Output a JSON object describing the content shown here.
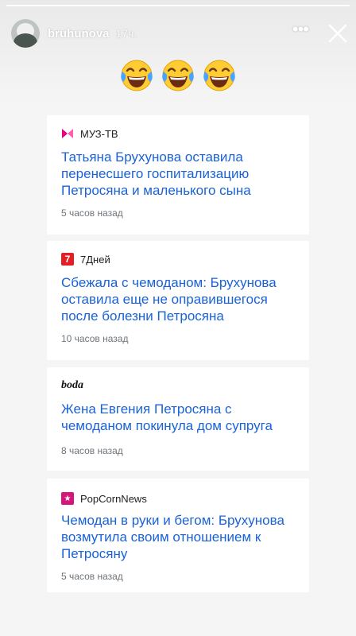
{
  "story": {
    "username": "bruhunova",
    "time": "17ч.",
    "more_label": "•••",
    "emojis": [
      "face-with-tears-of-joy",
      "face-with-tears-of-joy",
      "face-with-tears-of-joy"
    ]
  },
  "articles": [
    {
      "source": "МУЗ-ТВ",
      "source_icon": "muz-tv-logo",
      "title": "Татьяна Брухунова оставила перенесшего госпитализацию Петросяна и маленького сына",
      "ago": "5 часов назад"
    },
    {
      "source": "7Дней",
      "source_icon": "7dney-logo",
      "icon_text": "7",
      "title": "Сбежала с чемоданом: Брухунова оставила еще не оправившегося после болезни Петросяна",
      "ago": "10 часов назад"
    },
    {
      "source": "boda",
      "source_icon": "boda-logo",
      "title": "Жена Евгения Петросяна с чемоданом покинула дом супруга",
      "ago": "8 часов назад"
    },
    {
      "source": "PopCornNews",
      "source_icon": "popcornnews-logo",
      "icon_text": "★",
      "title": "Чемодан в руки и бегом: Брухунова возмутила своим отношением к Петросяну",
      "ago": "5 часов назад"
    }
  ],
  "colors": {
    "link": "#1a62d6",
    "meta": "#70757a",
    "source": "#202124",
    "background": "#f5f5f5"
  }
}
